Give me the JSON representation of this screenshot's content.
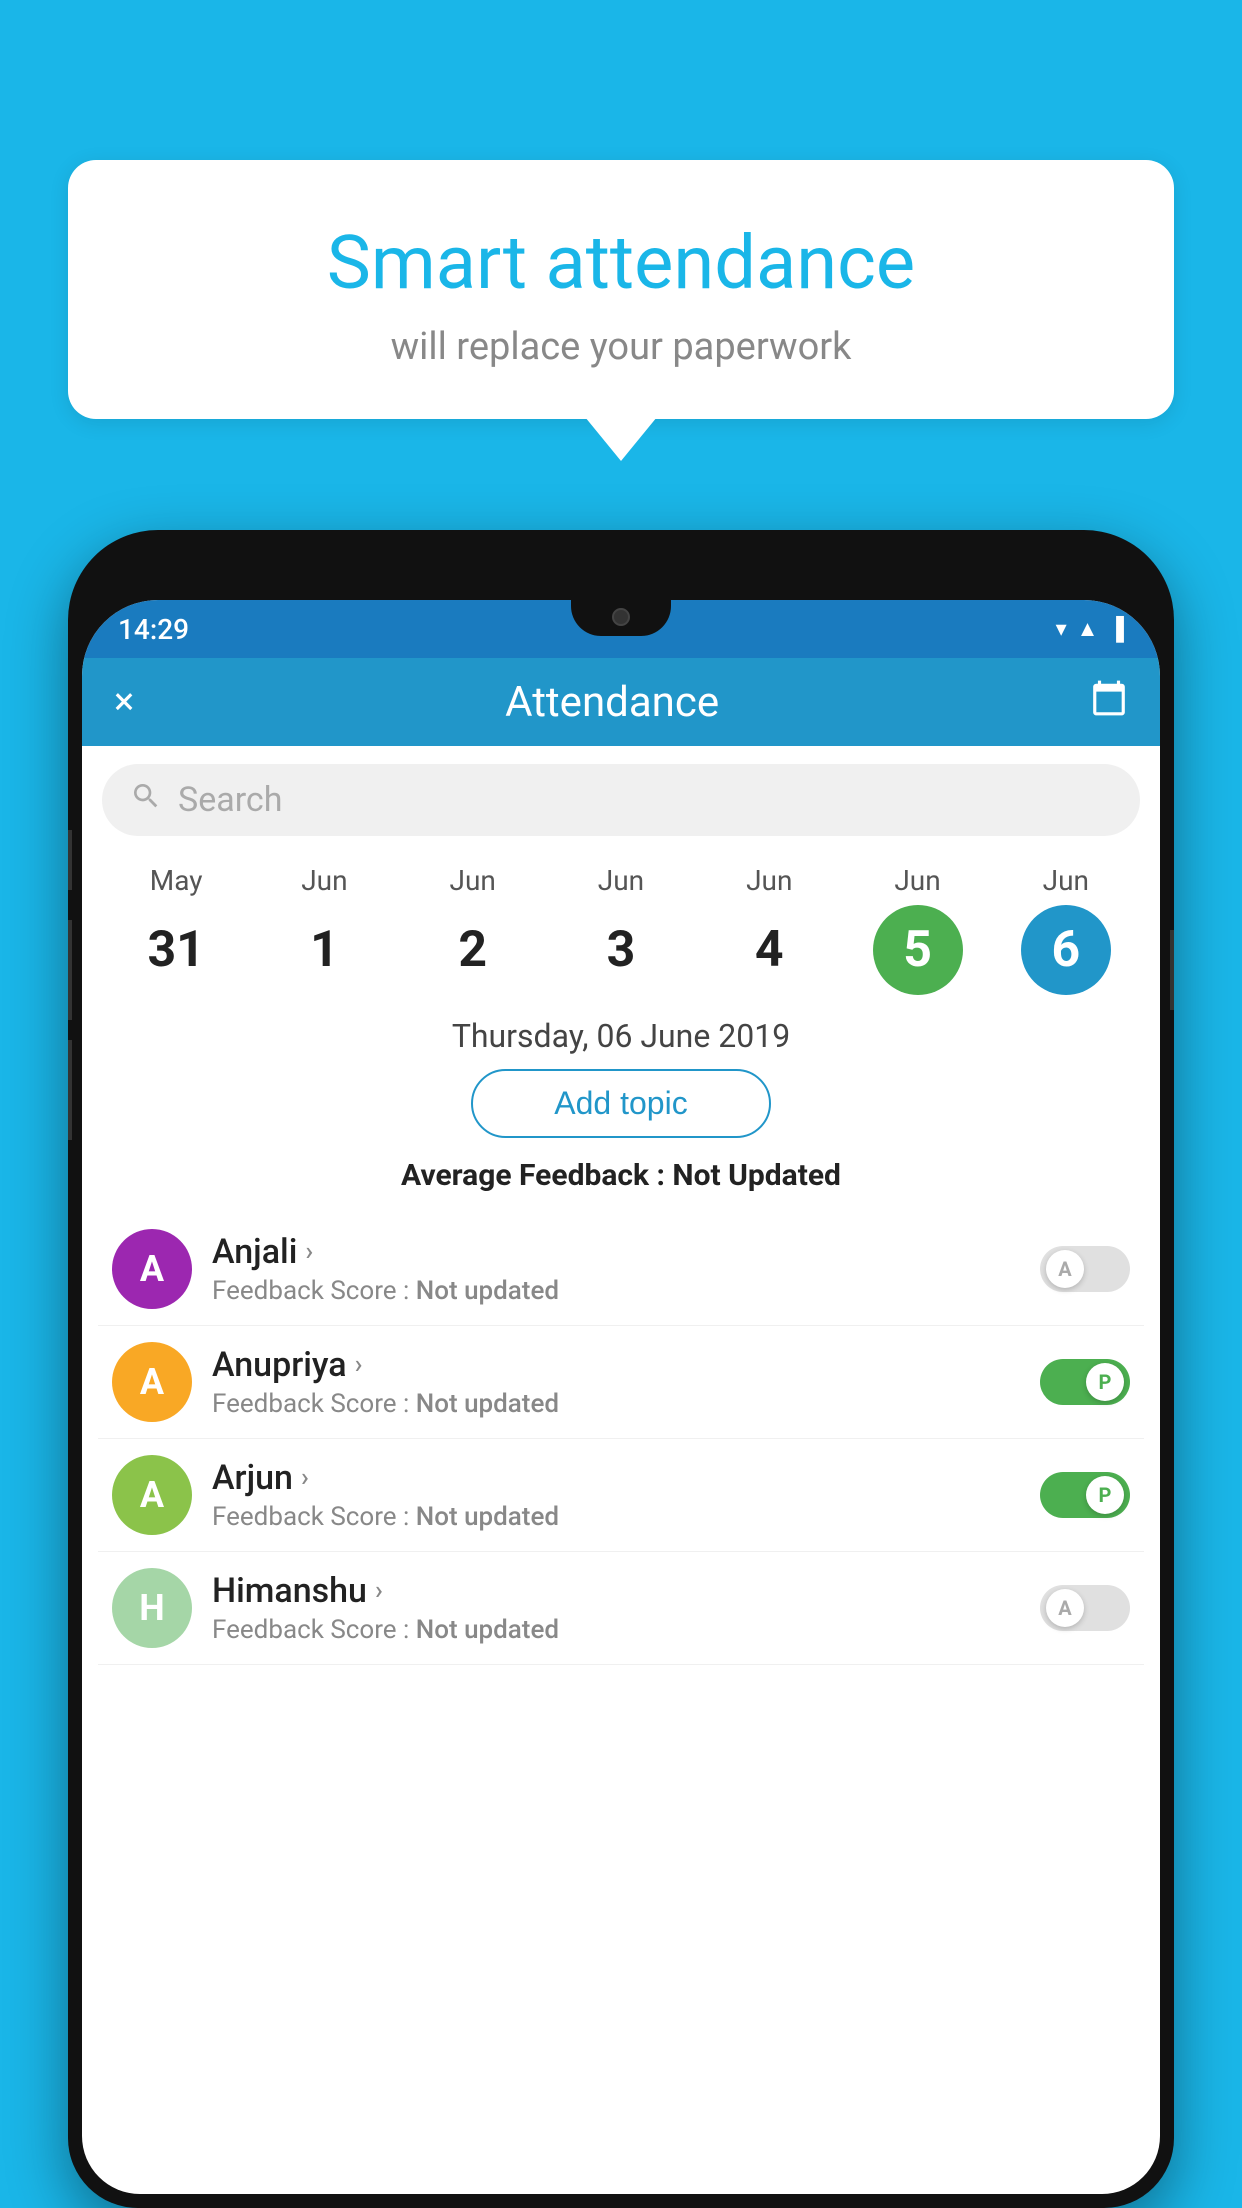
{
  "background_color": "#1ab6e8",
  "bubble": {
    "title": "Smart attendance",
    "subtitle": "will replace your paperwork"
  },
  "status_bar": {
    "time": "14:29",
    "icons": [
      "wifi",
      "signal",
      "battery"
    ]
  },
  "header": {
    "title": "Attendance",
    "close_label": "×",
    "calendar_label": "📅"
  },
  "search": {
    "placeholder": "Search"
  },
  "calendar": {
    "days": [
      {
        "month": "May",
        "date": "31",
        "state": "normal"
      },
      {
        "month": "Jun",
        "date": "1",
        "state": "normal"
      },
      {
        "month": "Jun",
        "date": "2",
        "state": "normal"
      },
      {
        "month": "Jun",
        "date": "3",
        "state": "normal"
      },
      {
        "month": "Jun",
        "date": "4",
        "state": "normal"
      },
      {
        "month": "Jun",
        "date": "5",
        "state": "today"
      },
      {
        "month": "Jun",
        "date": "6",
        "state": "selected"
      }
    ],
    "selected_date_label": "Thursday, 06 June 2019"
  },
  "add_topic_button": "Add topic",
  "avg_feedback": {
    "label": "Average Feedback :",
    "value": "Not Updated"
  },
  "students": [
    {
      "name": "Anjali",
      "avatar_letter": "A",
      "avatar_color": "#9c27b0",
      "feedback_label": "Feedback Score :",
      "feedback_value": "Not updated",
      "toggle_state": "off",
      "toggle_letter": "A"
    },
    {
      "name": "Anupriya",
      "avatar_letter": "A",
      "avatar_color": "#f9a825",
      "feedback_label": "Feedback Score :",
      "feedback_value": "Not updated",
      "toggle_state": "on",
      "toggle_letter": "P"
    },
    {
      "name": "Arjun",
      "avatar_letter": "A",
      "avatar_color": "#8bc34a",
      "feedback_label": "Feedback Score :",
      "feedback_value": "Not updated",
      "toggle_state": "on",
      "toggle_letter": "P"
    },
    {
      "name": "Himanshu",
      "avatar_letter": "H",
      "avatar_color": "#a5d6a7",
      "feedback_label": "Feedback Score :",
      "feedback_value": "Not updated",
      "toggle_state": "off",
      "toggle_letter": "A"
    }
  ]
}
